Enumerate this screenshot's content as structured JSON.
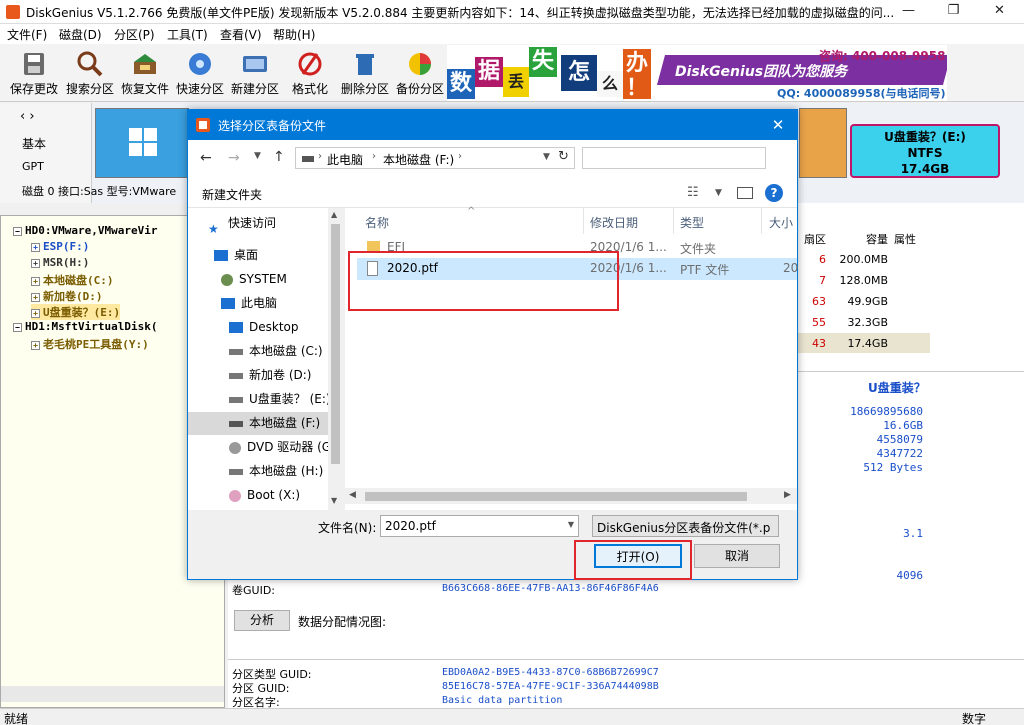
{
  "window": {
    "title": "DiskGenius V5.1.2.766 免费版(单文件PE版)   发现新版本 V5.2.0.884 主要更新内容如下：14、纠正转换虚拟磁盘类型功能，无法选择已经加载的虚拟磁盘的问..."
  },
  "menu": [
    "文件(F)",
    "磁盘(D)",
    "分区(P)",
    "工具(T)",
    "查看(V)",
    "帮助(H)"
  ],
  "toolbar": [
    "保存更改",
    "搜索分区",
    "恢复文件",
    "快速分区",
    "新建分区",
    "格式化",
    "删除分区",
    "备份分区"
  ],
  "banner": {
    "chars": [
      "数",
      "据",
      "丢",
      "失",
      "怎",
      "么",
      "办",
      "！"
    ],
    "brand": "DiskGenius团队为您服务",
    "phone": "咨询: 400-008-9958",
    "qq": "QQ: 4000089958(与电话同号)"
  },
  "disk_strip": {
    "nav": "‹ ›",
    "type1": "基本",
    "type2": "GPT",
    "info": "磁盘 0 接口:Sas  型号:VMware",
    "partition": {
      "name": "U盘重装？(E:)",
      "fs": "NTFS",
      "size": "17.4GB"
    }
  },
  "tree": {
    "items": [
      {
        "label": "HD0:VMware,VMwareVir",
        "color": "#000000"
      },
      {
        "label": "ESP(F:)",
        "color": "#1a4ec9"
      },
      {
        "label": "MSR(H:)",
        "color": "#333333"
      },
      {
        "label": "本地磁盘(C:)",
        "color": "#7a5c00"
      },
      {
        "label": "新加卷(D:)",
        "color": "#7a5c00"
      },
      {
        "label": "U盘重装？(E:)",
        "color": "#7a5c00"
      },
      {
        "label": "HD1:MsftVirtualDisk(",
        "color": "#000000"
      },
      {
        "label": "老毛桃PE工具盘(Y:)",
        "color": "#7a5c00"
      }
    ]
  },
  "partition_table": {
    "headers": [
      "扇区",
      "容量",
      "属性"
    ],
    "rows": [
      {
        "sector": "6",
        "size": "200.0MB"
      },
      {
        "sector": "7",
        "size": "128.0MB"
      },
      {
        "sector": "63",
        "size": "49.9GB"
      },
      {
        "sector": "55",
        "size": "32.3GB"
      },
      {
        "sector": "43",
        "size": "17.4GB"
      }
    ]
  },
  "details": {
    "title": "U盘重装？",
    "values": [
      "18669895680",
      "16.6GB",
      "4558079",
      "4347722",
      "512 Bytes"
    ],
    "v2": "3.1",
    "v3": "4096",
    "vol_guid_label": "卷GUID:",
    "vol_guid": "B663C668-86EE-47FB-AA13-86F46F86F4A6",
    "analyze_button": "分析",
    "analyze_label": "数据分配情况图:",
    "type_guid_label": "分区类型 GUID:",
    "type_guid": "EBD0A0A2-B9E5-4433-87C0-68B6B72699C7",
    "part_guid_label": "分区 GUID:",
    "part_guid": "85E16C78-57EA-47FE-9C1F-336A7444098B",
    "part_name_label": "分区名字:",
    "part_name": "Basic data partition"
  },
  "status": {
    "left": "就绪",
    "right": "数字"
  },
  "dialog": {
    "title": "选择分区表备份文件",
    "path": [
      "此电脑",
      "本地磁盘 (F:)"
    ],
    "new_folder": "新建文件夹",
    "nav": [
      {
        "label": "快速访问",
        "icon": "star-icon"
      },
      {
        "label": "桌面",
        "icon": "desktop-icon"
      },
      {
        "label": "SYSTEM",
        "icon": "user-icon"
      },
      {
        "label": "此电脑",
        "icon": "computer-icon"
      },
      {
        "label": "Desktop",
        "icon": "desktop-icon"
      },
      {
        "label": "本地磁盘 (C:)",
        "icon": "drive-icon"
      },
      {
        "label": "新加卷 (D:)",
        "icon": "drive-icon"
      },
      {
        "label": "U盘重装？ (E:)",
        "icon": "drive-icon"
      },
      {
        "label": "本地磁盘 (F:)",
        "icon": "drive-icon"
      },
      {
        "label": "DVD 驱动器 (G",
        "icon": "dvd-icon"
      },
      {
        "label": "本地磁盘 (H:)",
        "icon": "drive-icon"
      },
      {
        "label": "Boot (X:)",
        "icon": "boot-icon"
      }
    ],
    "columns": [
      "名称",
      "修改日期",
      "类型",
      "大小"
    ],
    "files": [
      {
        "name": "EFI",
        "date": "2020/1/6 1...",
        "type": "文件夹",
        "size": ""
      },
      {
        "name": "2020.ptf",
        "date": "2020/1/6 1...",
        "type": "PTF 文件",
        "size": "20"
      }
    ],
    "filename_label": "文件名(N):",
    "filename": "2020.ptf",
    "filter": "DiskGenius分区表备份文件(*.p",
    "open": "打开(O)",
    "cancel": "取消"
  }
}
